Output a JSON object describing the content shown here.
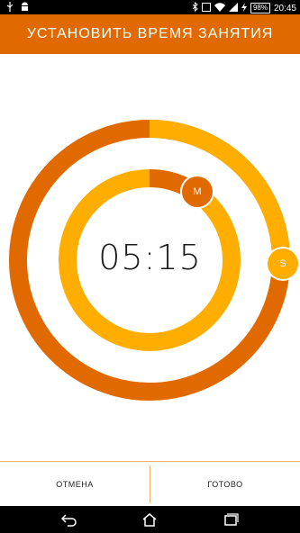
{
  "status_bar": {
    "left_icons": [
      "usb-icon",
      "android-icon"
    ],
    "right_icons": [
      "bluetooth-icon",
      "nfc-icon",
      "wifi-icon",
      "signal-icon",
      "charging-icon"
    ],
    "battery": "98%",
    "time": "20:45"
  },
  "header": {
    "title": "УСТАНОВИТЬ  ВРЕМЯ  ЗАНЯТИЯ"
  },
  "timer": {
    "time": "05:15",
    "minutes": 5,
    "seconds": 15,
    "minutes_knob_label": "M",
    "seconds_knob_label": "S"
  },
  "buttons": {
    "cancel": "ОТМЕНА",
    "done": "ГОТОВО"
  },
  "colors": {
    "accent": "#E06A00",
    "secondary": "#FFAE00",
    "divider": "#F2B26C"
  },
  "nav_bar": {
    "icons": [
      "back-icon",
      "home-icon",
      "recent-apps-icon"
    ]
  }
}
